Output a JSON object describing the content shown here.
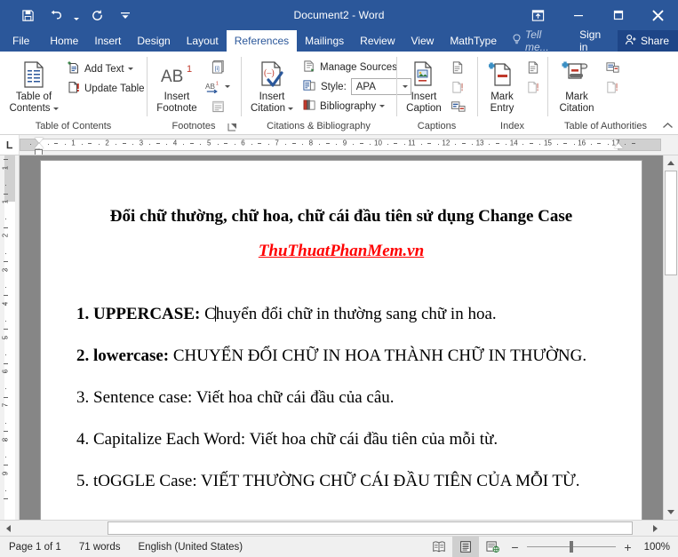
{
  "titlebar": {
    "title": "Document2 - Word",
    "qat": [
      {
        "name": "save",
        "icon": "save-icon"
      },
      {
        "name": "undo",
        "icon": "undo-icon"
      },
      {
        "name": "redo",
        "icon": "redo-icon"
      },
      {
        "name": "customize-quick-access-toolbar",
        "icon": "chevron-down-icon"
      }
    ],
    "window_controls": [
      {
        "name": "ribbon-display-options",
        "icon": "ribbon-display-options-icon"
      },
      {
        "name": "minimize",
        "icon": "minimize-icon"
      },
      {
        "name": "restore",
        "icon": "restore-icon"
      },
      {
        "name": "close",
        "icon": "close-icon"
      }
    ]
  },
  "tabs": [
    {
      "label": "File",
      "active": false
    },
    {
      "label": "Home",
      "active": false
    },
    {
      "label": "Insert",
      "active": false
    },
    {
      "label": "Design",
      "active": false
    },
    {
      "label": "Layout",
      "active": false
    },
    {
      "label": "References",
      "active": true
    },
    {
      "label": "Mailings",
      "active": false
    },
    {
      "label": "Review",
      "active": false
    },
    {
      "label": "View",
      "active": false
    },
    {
      "label": "MathType",
      "active": false
    }
  ],
  "tabbar_right": {
    "tell_me": "Tell me...",
    "sign_in": "Sign in",
    "share": "Share"
  },
  "ribbon": {
    "groups": [
      {
        "name": "table-of-contents",
        "label": "Table of Contents",
        "big_button": {
          "line1": "Table of",
          "line2": "Contents",
          "has_caret": true
        },
        "small_buttons": [
          {
            "label": "Add Text",
            "has_caret": true,
            "icon": "add-text-icon"
          },
          {
            "label": "Update Table",
            "has_caret": false,
            "icon": "update-table-icon"
          }
        ]
      },
      {
        "name": "footnotes",
        "label": "Footnotes",
        "big_button": {
          "line1": "Insert",
          "line2": "Footnote",
          "glyph": "AB1"
        },
        "icons": [
          {
            "name": "insert-endnote-icon"
          },
          {
            "name": "next-footnote-icon",
            "has_caret": true
          },
          {
            "name": "show-notes-icon"
          }
        ],
        "dialog_launcher": true
      },
      {
        "name": "citations-and-bibliography",
        "label": "Citations & Bibliography",
        "big_button": {
          "line1": "Insert",
          "line2": "Citation",
          "has_caret": true
        },
        "small_buttons": [
          {
            "label": "Manage Sources",
            "icon": "manage-sources-icon"
          },
          {
            "label": "Style:",
            "icon": "style-icon",
            "value": "APA"
          },
          {
            "label": "Bibliography",
            "icon": "bibliography-icon",
            "has_caret": true
          }
        ]
      },
      {
        "name": "captions",
        "label": "Captions",
        "big_button": {
          "line1": "Insert",
          "line2": "Caption"
        },
        "icons": [
          {
            "name": "insert-table-of-figures-icon"
          },
          {
            "name": "update-table-icon"
          },
          {
            "name": "cross-reference-icon"
          }
        ]
      },
      {
        "name": "index",
        "label": "Index",
        "big_button": {
          "line1": "Mark",
          "line2": "Entry"
        },
        "icons": [
          {
            "name": "insert-index-icon"
          },
          {
            "name": "update-index-icon"
          }
        ]
      },
      {
        "name": "table-of-authorities",
        "label": "Table of Authorities",
        "big_button": {
          "line1": "Mark",
          "line2": "Citation"
        },
        "icons": [
          {
            "name": "insert-table-of-authorities-icon"
          },
          {
            "name": "update-table-icon"
          }
        ]
      }
    ],
    "collapse_icon": "chevron-up-icon"
  },
  "ruler": {
    "corner_label": "L",
    "h_ticks": [
      "1",
      "2",
      "3",
      "4",
      "5",
      "6",
      "7",
      "8",
      "9",
      "10",
      "11",
      "12",
      "13",
      "14",
      "15",
      "16",
      "17"
    ],
    "v_ticks": [
      "1",
      "1",
      "2",
      "3",
      "4",
      "5",
      "6",
      "7",
      "8",
      "9"
    ]
  },
  "document": {
    "title": "Đổi chữ thường, chữ hoa, chữ cái đầu tiên sử dụng Change Case",
    "subtitle": "ThuThuatPhanMem.vn",
    "subtitle_color": "#ff0000",
    "paragraphs": [
      {
        "bold": "1. UPPERCASE:",
        "before_caret": " C",
        "after_caret": "huyển đổi chữ in thường sang chữ in hoa.",
        "has_caret": true
      },
      {
        "bold": "2. lowercase:",
        "rest": " CHUYỂN ĐỔI CHỮ IN HOA THÀNH CHỮ IN THƯỜNG."
      },
      {
        "bold": "",
        "rest": "3. Sentence case: Viết hoa chữ cái đầu của câu."
      },
      {
        "bold": "",
        "rest": "4. Capitalize Each Word: Viết hoa chữ cái đầu tiên của mỗi từ."
      },
      {
        "bold": "",
        "rest": "5. tOGGLE Case: VIẾT THƯỜNG CHỮ CÁI ĐẦU TIÊN CỦA MỖI TỪ."
      }
    ]
  },
  "statusbar": {
    "page": "Page 1 of 1",
    "words": "71 words",
    "language": "English (United States)",
    "views": [
      {
        "name": "read-mode-icon",
        "active": false
      },
      {
        "name": "print-layout-icon",
        "active": true
      },
      {
        "name": "web-layout-icon",
        "active": false
      }
    ],
    "zoom_out": "−",
    "zoom_in": "+",
    "zoom_level": "100%"
  }
}
